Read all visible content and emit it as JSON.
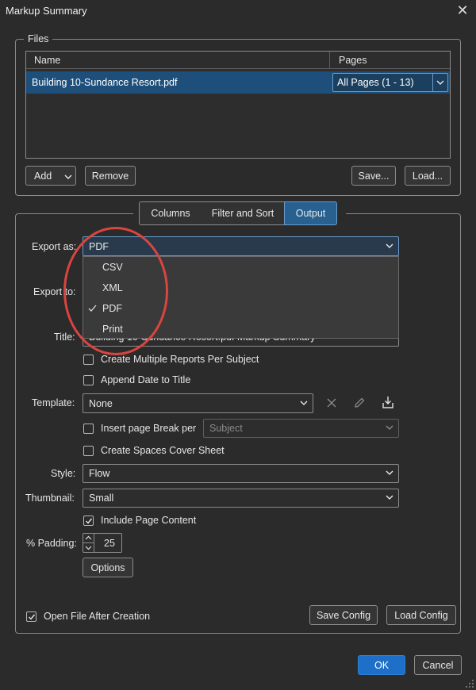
{
  "window": {
    "title": "Markup Summary"
  },
  "files": {
    "legend": "Files",
    "columns": {
      "name": "Name",
      "pages": "Pages"
    },
    "rows": [
      {
        "name": "Building 10-Sundance Resort.pdf",
        "pages": "All Pages (1 - 13)"
      }
    ],
    "buttons": {
      "add": "Add",
      "remove": "Remove",
      "save": "Save...",
      "load": "Load..."
    }
  },
  "tabs": {
    "columns": "Columns",
    "filter_sort": "Filter and Sort",
    "output": "Output",
    "active": "Output"
  },
  "output": {
    "export_as_label": "Export as:",
    "export_as_value": "PDF",
    "export_options": [
      "CSV",
      "XML",
      "PDF",
      "Print"
    ],
    "export_selected": "PDF",
    "export_to_label": "Export to:",
    "title_label": "Title:",
    "title_value": "Building 10-Sundance Resort.pdf Markup Summary",
    "create_multiple_reports": {
      "label": "Create Multiple Reports Per Subject",
      "checked": false
    },
    "append_date": {
      "label": "Append Date to Title",
      "checked": false
    },
    "template_label": "Template:",
    "template_value": "None",
    "insert_page_break": {
      "label": "Insert page Break per",
      "checked": false
    },
    "page_break_value": "Subject",
    "create_cover_sheet": {
      "label": "Create Spaces Cover Sheet",
      "checked": false
    },
    "style_label": "Style:",
    "style_value": "Flow",
    "thumbnail_label": "Thumbnail:",
    "thumbnail_value": "Small",
    "include_page_content": {
      "label": "Include Page Content",
      "checked": true
    },
    "padding_label": "% Padding:",
    "padding_value": "25",
    "options_button": "Options",
    "open_after_creation": {
      "label": "Open File After Creation",
      "checked": true
    },
    "save_config": "Save Config",
    "load_config": "Load Config"
  },
  "footer": {
    "ok": "OK",
    "cancel": "Cancel"
  },
  "colors": {
    "accent": "#1d6fc7",
    "selection": "#1e4f7a",
    "active_tab": "#28618f",
    "highlight_circle": "#d9453f"
  }
}
